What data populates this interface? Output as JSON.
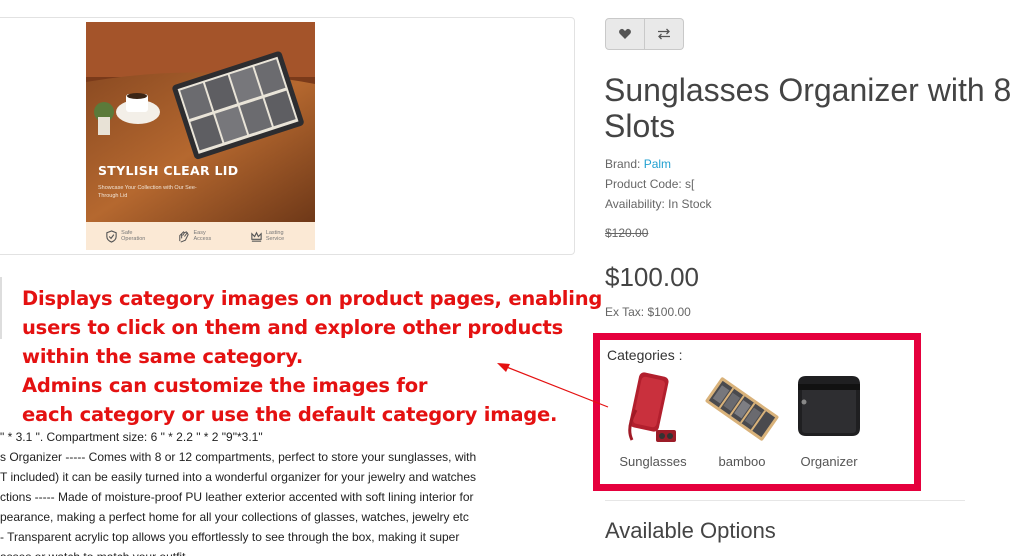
{
  "product_image": {
    "caption_title": "STYLISH CLEAR LID",
    "caption_sub": "Showcase Your Collection with Our See-Through Lid",
    "features": [
      {
        "icon": "shield-check-icon",
        "label": "Safe Operation"
      },
      {
        "icon": "hand-icon",
        "label": "Easy Access"
      },
      {
        "icon": "crown-icon",
        "label": "Lasting Service"
      }
    ]
  },
  "actions": {
    "wishlist_icon": "heart-icon",
    "compare_icon": "compare-arrows-icon"
  },
  "product": {
    "title": "Sunglasses Organizer with 8 Slots",
    "brand_label": "Brand: ",
    "brand_value": "Palm",
    "code_label": "Product Code: ",
    "code_value": "s[",
    "availability_label": "Availability: ",
    "availability_value": "In Stock",
    "old_price": "$120.00",
    "price": "$100.00",
    "ex_tax": "Ex Tax: $100.00"
  },
  "categories": {
    "label": "Categories :",
    "items": [
      {
        "name": "Sunglasses"
      },
      {
        "name": "bamboo"
      },
      {
        "name": "Organizer"
      }
    ]
  },
  "options": {
    "heading": "Available Options"
  },
  "annotation": {
    "lines": [
      "Displays category images on product pages, enabling",
      " users to click on them and explore other products",
      "within the same category.",
      "Admins can customize the images for",
      "each category or use the default category image."
    ]
  },
  "description": {
    "lines": [
      "\" * 3.1 \". Compartment size: 6 \" * 2.2 \" * 2 \"9\"*3.1\"",
      "s Organizer ----- Comes with 8 or 12 compartments, perfect to store your sunglasses, with",
      "T included) it can be easily turned into a wonderful organizer for your jewelry and watches",
      "ctions ----- Made of moisture-proof PU leather exterior accented with soft lining interior for",
      "pearance, making a perfect home for all your collections of glasses, watches, jewelry etc",
      "- Transparent acrylic top allows you effortlessly to see through the box, making it super",
      "asses or watch to match your outfit."
    ]
  },
  "colors": {
    "annotation_red": "#e41111",
    "highlight_border": "#e5003d",
    "link_blue": "#23a1d1"
  }
}
